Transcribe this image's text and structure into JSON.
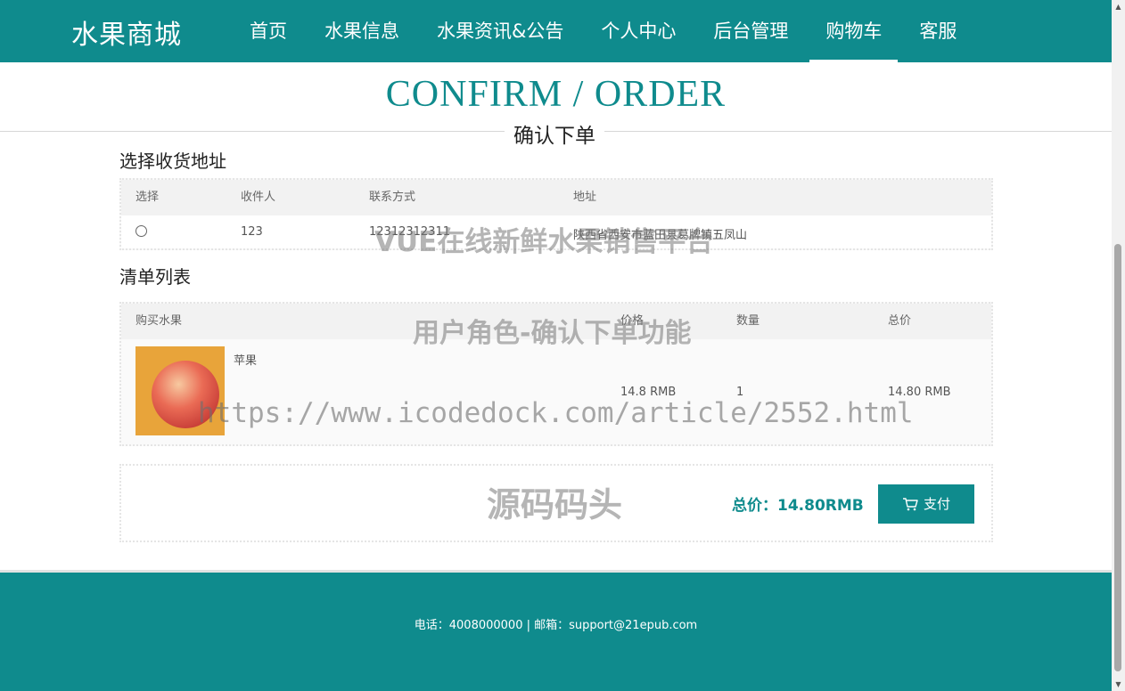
{
  "header": {
    "logo": "水果商城",
    "nav": [
      {
        "label": "首页"
      },
      {
        "label": "水果信息"
      },
      {
        "label": "水果资讯&公告"
      },
      {
        "label": "个人中心"
      },
      {
        "label": "后台管理"
      },
      {
        "label": "购物车"
      },
      {
        "label": "客服"
      }
    ],
    "active_index": 5
  },
  "title": {
    "en": "CONFIRM / ORDER",
    "cn": "确认下单"
  },
  "address_section": {
    "title": "选择收货地址",
    "columns": [
      "选择",
      "收件人",
      "联系方式",
      "地址"
    ],
    "rows": [
      {
        "recipient": "123",
        "phone": "12312312311",
        "address": "陕西省西安市蓝田县葛牌镇五凤山"
      }
    ]
  },
  "list_section": {
    "title": "清单列表",
    "columns": [
      "购买水果",
      "价格",
      "数量",
      "总价"
    ],
    "items": [
      {
        "name": "苹果",
        "price": "14.8 RMB",
        "qty": "1",
        "total": "14.80 RMB",
        "image_icon": "apple-image"
      }
    ]
  },
  "checkout": {
    "total_label": "总价：14.80RMB",
    "pay_label": "支付",
    "pay_icon": "cart-icon"
  },
  "footer": {
    "text": "电话：4008000000 | 邮箱：support@21epub.com"
  },
  "watermarks": {
    "line1": "VUE在线新鲜水果销售平台",
    "line2": "用户角色-确认下单功能",
    "line3": "https://www.icodedock.com/article/2552.html",
    "line4": "源码码头"
  },
  "colors": {
    "primary": "#0f8b8d",
    "header_bg": "#0f8b8d",
    "footer_bg": "#0f8b8d"
  }
}
